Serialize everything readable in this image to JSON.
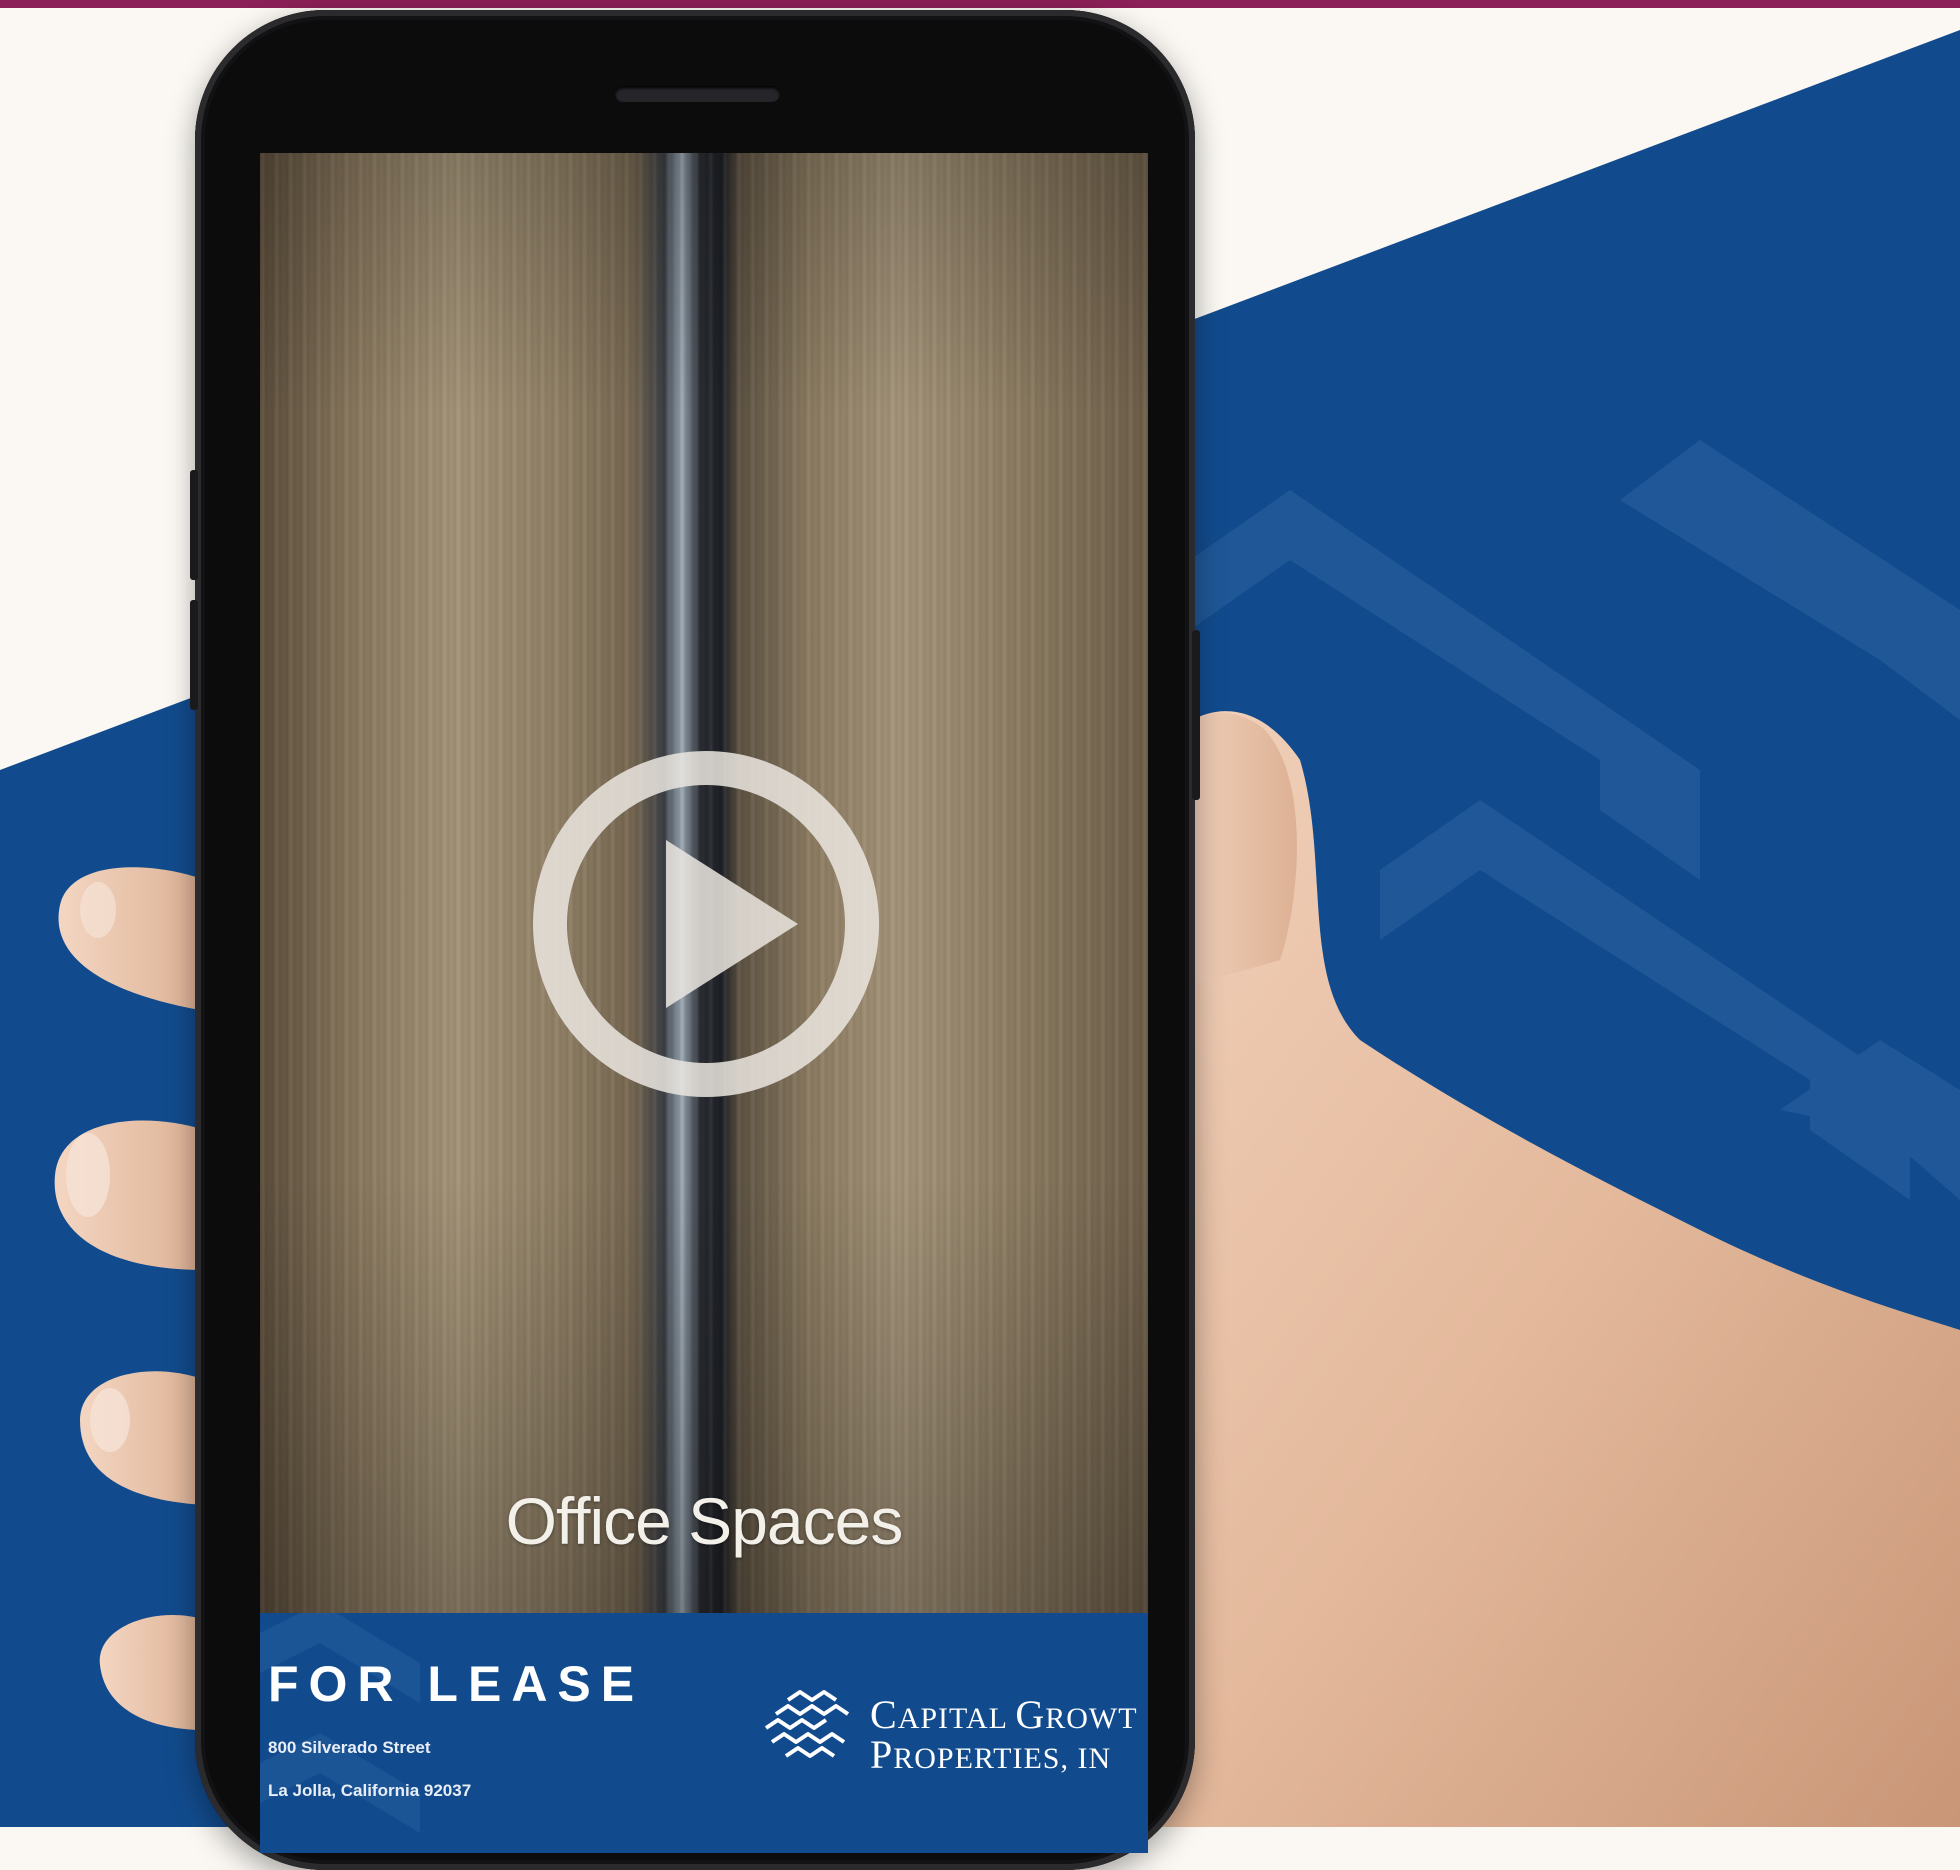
{
  "colors": {
    "top_strip": "#8b1f57",
    "background_light": "#fbf8f3",
    "background_blue": "#124b8d",
    "banner_blue": "#124b8d"
  },
  "video": {
    "caption": "Office Spaces",
    "play_icon": "play-icon"
  },
  "banner": {
    "headline": "FOR LEASE",
    "address_line_1": "800 Silverado Street",
    "address_line_2": "La Jolla, California 92037",
    "brand_line_1": {
      "initial_1": "C",
      "rest_1": "APITAL ",
      "initial_2": "G",
      "rest_2": "ROWT"
    },
    "brand_line_2": {
      "initial_1": "P",
      "rest_1": "ROPERTIES, ",
      "rest_2": "IN"
    },
    "logo_icon": "stacked-chevrons-logo-icon"
  }
}
